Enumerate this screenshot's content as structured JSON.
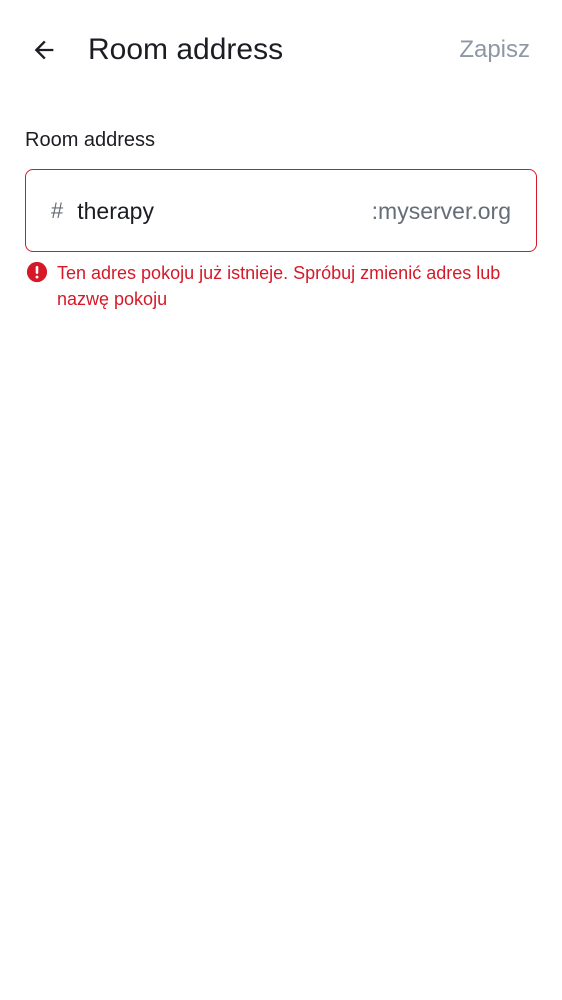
{
  "header": {
    "title": "Room address",
    "save_label": "Zapisz",
    "back_icon": "arrow-left-icon"
  },
  "form": {
    "label": "Room address",
    "prefix": "#",
    "value": "therapy",
    "suffix": ":myserver.org",
    "error_icon": "error-circle-icon",
    "error_message": "Ten adres pokoju już istnieje. Spróbuj zmienić adres lub nazwę pokoju"
  },
  "colors": {
    "error": "#d51928",
    "muted": "#8d97a5",
    "text": "#1b1d22",
    "secondary": "#656d77"
  }
}
